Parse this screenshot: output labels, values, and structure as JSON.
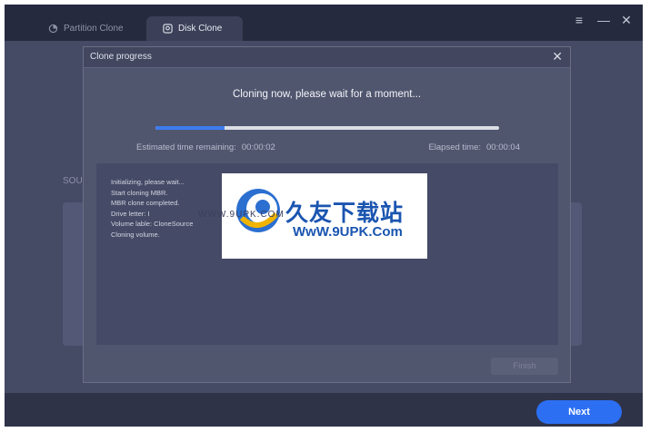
{
  "tabs": [
    {
      "label": "Partition Clone",
      "icon": "partition-icon"
    },
    {
      "label": "Disk Clone",
      "icon": "disk-icon"
    }
  ],
  "window_controls": {
    "menu": "≡",
    "minimize": "—",
    "close": "✕"
  },
  "background": {
    "section_label": "SOU",
    "next_label": "Next"
  },
  "dialog": {
    "title": "Clone progress",
    "close": "✕",
    "status_message": "Cloning now, please wait for a moment...",
    "progress_fraction": 0.2,
    "eta_label": "Estimated time remaining:",
    "eta_value": "00:00:02",
    "elapsed_label": "Elapsed time:",
    "elapsed_value": "00:00:04",
    "log": [
      "Initializing, please wait...",
      "Start cloning MBR.",
      "MBR clone completed.",
      "Drive letter: I",
      "Volume lable: CloneSource",
      "Cloning volume."
    ],
    "finish_label": "Finish"
  },
  "watermark": {
    "title": "久友下载站",
    "url": "WwW.9UPK.Com",
    "small": "WWW.9UPK.COM"
  },
  "colors": {
    "accent": "#2c6ff2",
    "progress": "#3d7cf0",
    "background": "#3b3f57"
  }
}
